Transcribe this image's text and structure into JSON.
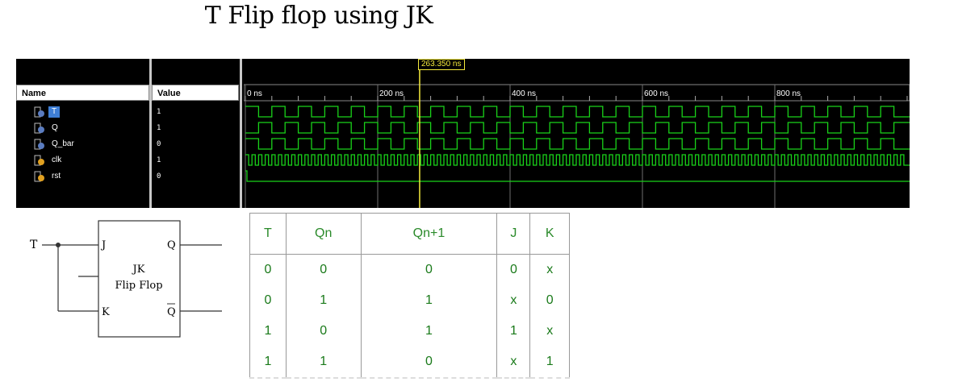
{
  "title": "T Flip flop using JK",
  "simulator": {
    "name_header": "Name",
    "value_header": "Value",
    "cursor_time": "263.350 ns",
    "time_ticks": [
      "0 ns",
      "200 ns",
      "400 ns",
      "600 ns",
      "800 ns"
    ],
    "signals": [
      {
        "name": "T",
        "value": "1",
        "selected": true
      },
      {
        "name": "Q",
        "value": "1",
        "selected": false
      },
      {
        "name": "Q_bar",
        "value": "0",
        "selected": false
      },
      {
        "name": "clk",
        "value": "1",
        "selected": false
      },
      {
        "name": "rst",
        "value": "0",
        "selected": false
      }
    ],
    "colors": {
      "wave": "#19d219",
      "cursor": "#f5ea3c",
      "grid": "#6e6e6e",
      "selection": "#3f7fd6"
    }
  },
  "diagram": {
    "input_label": "T",
    "j_label": "J",
    "k_label": "K",
    "q_label": "Q",
    "qbar_label": "Q",
    "block_line1": "JK",
    "block_line2": "Flip Flop"
  },
  "truth_table": {
    "headers": [
      "T",
      "Qn",
      "Qn+1",
      "J",
      "K"
    ],
    "rows": [
      [
        "0",
        "0",
        "0",
        "0",
        "x"
      ],
      [
        "0",
        "1",
        "1",
        "x",
        "0"
      ],
      [
        "1",
        "0",
        "1",
        "1",
        "x"
      ],
      [
        "1",
        "1",
        "0",
        "x",
        "1"
      ]
    ],
    "text_color": "#1a7a1a"
  }
}
